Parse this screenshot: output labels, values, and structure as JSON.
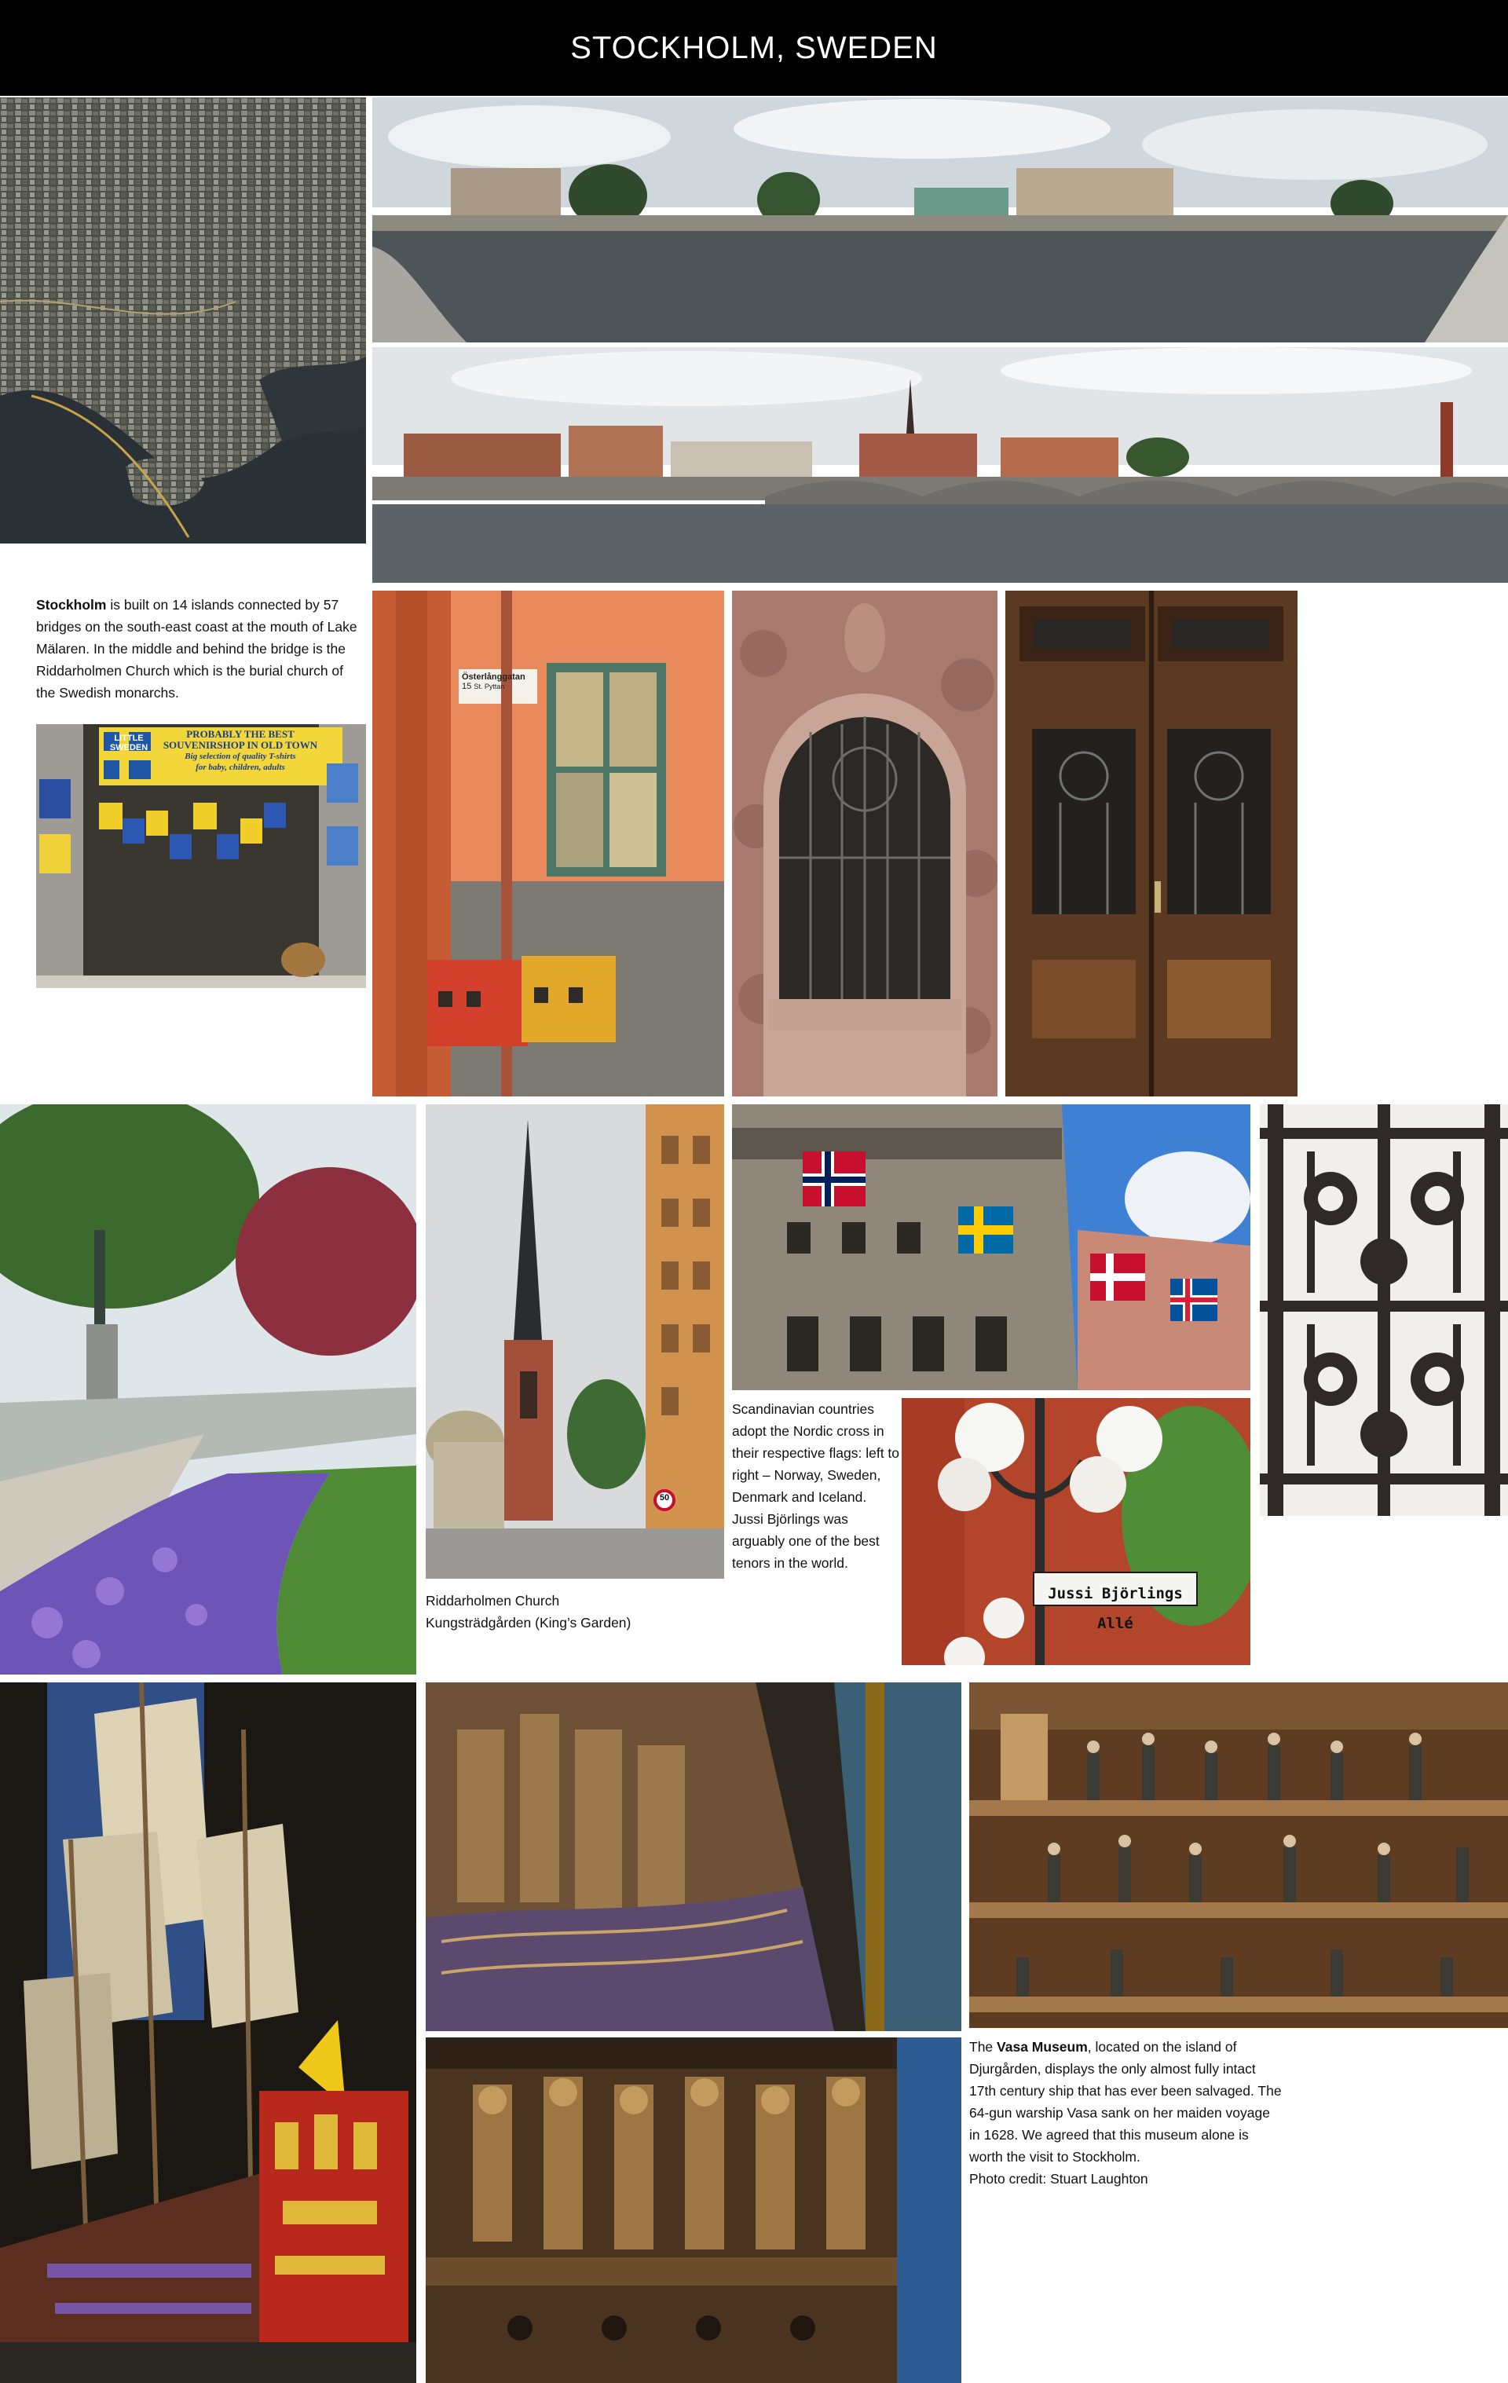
{
  "header": {
    "title": "STOCKHOLM, SWEDEN"
  },
  "captions": {
    "stockholm": {
      "lead": "Stockholm",
      "text": " is built on 14 islands connected by 57 bridges on the south-east coast at the mouth of Lake Mälaren. In the middle and behind the bridge is the Riddarholmen Church which is the burial church of the Swedish monarchs."
    },
    "church": {
      "line1": "Riddarholmen Church",
      "line2": "Kungsträdgården (King’s Garden)"
    },
    "flags": {
      "text": "Scandinavian countries adopt the Nordic cross in their respective flags: left to right – Norway, Sweden, Denmark and Iceland. Jussi Björlings was arguably one of the best tenors in the world."
    },
    "vasa": {
      "pre": "The ",
      "lead": "Vasa Museum",
      "text": ", located on the island of Djurgården, displays the only almost fully intact 17th century ship that has ever been salvaged. The 64-gun warship Vasa sank on her maiden voyage in 1628. We agreed that this museum alone is worth the visit to Stockholm.",
      "credit": "Photo credit: Stuart Laughton"
    }
  },
  "signs": {
    "souvenir_brand": "LITTLE SWEDEN",
    "souvenir_line1": "PROBABLY THE BEST",
    "souvenir_line2": "SOUVENIRSHOP IN OLD TOWN",
    "souvenir_line3": "Big selection of quality T-shirts",
    "souvenir_line4": "for baby, children, adults",
    "street_name": "Österlånggatan",
    "street_number": "15",
    "street_sub": "St. Pyttan",
    "jussi_sign": "Jussi Björlings Allé",
    "speed_sign": "50"
  },
  "colors": {
    "header_bg": "#000000",
    "header_text": "#ffffff",
    "norway_red": "#c8102e",
    "sweden_blue": "#006aa7",
    "sweden_yellow": "#fecc00"
  }
}
